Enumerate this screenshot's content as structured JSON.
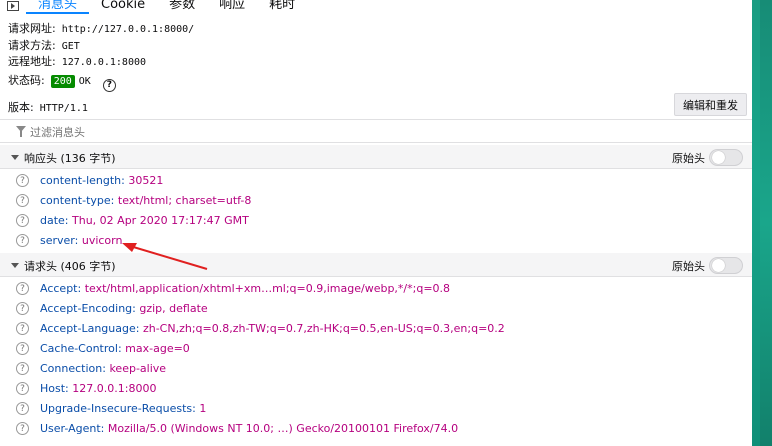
{
  "tabs": [
    {
      "label": "消息头",
      "active": true
    },
    {
      "label": "Cookie",
      "active": false
    },
    {
      "label": "参数",
      "active": false
    },
    {
      "label": "响应",
      "active": false
    },
    {
      "label": "耗时",
      "active": false
    }
  ],
  "summary": {
    "request_url_label": "请求网址:",
    "request_url": "http://127.0.0.1:8000/",
    "request_method_label": "请求方法:",
    "request_method": "GET",
    "remote_address_label": "远程地址:",
    "remote_address": "127.0.0.1:8000",
    "status_label": "状态码:",
    "status_code": "200",
    "status_text": "OK",
    "version_label": "版本:",
    "version": "HTTP/1.1"
  },
  "resend_button": "编辑和重发",
  "filter": {
    "placeholder": "过滤消息头"
  },
  "response_headers": {
    "title": "响应头 (136 字节)",
    "raw_label": "原始头",
    "items": [
      {
        "name": "content-length:",
        "value": "30521"
      },
      {
        "name": "content-type:",
        "value": "text/html; charset=utf-8"
      },
      {
        "name": "date:",
        "value": "Thu, 02 Apr 2020 17:17:47 GMT"
      },
      {
        "name": "server:",
        "value": "uvicorn"
      }
    ]
  },
  "request_headers": {
    "title": "请求头 (406 字节)",
    "raw_label": "原始头",
    "items": [
      {
        "name": "Accept:",
        "value": "text/html,application/xhtml+xm…ml;q=0.9,image/webp,*/*;q=0.8"
      },
      {
        "name": "Accept-Encoding:",
        "value": "gzip, deflate"
      },
      {
        "name": "Accept-Language:",
        "value": "zh-CN,zh;q=0.8,zh-TW;q=0.7,zh-HK;q=0.5,en-US;q=0.3,en;q=0.2"
      },
      {
        "name": "Cache-Control:",
        "value": "max-age=0"
      },
      {
        "name": "Connection:",
        "value": "keep-alive"
      },
      {
        "name": "Host:",
        "value": "127.0.0.1:8000"
      },
      {
        "name": "Upgrade-Insecure-Requests:",
        "value": "1"
      },
      {
        "name": "User-Agent:",
        "value": "Mozilla/5.0 (Windows NT 10.0; …) Gecko/20100101 Firefox/74.0"
      }
    ]
  },
  "icons": {
    "help": "?",
    "sidebar_toggle": "sidebar-toggle-icon",
    "filter": "filter-icon",
    "annotation": "red-arrow"
  },
  "colors": {
    "accent": "#0a84ff",
    "status_ok": "#058b00",
    "header_name": "#0a4da8",
    "header_value": "#b5007f",
    "annotation_arrow": "#e02020",
    "side_strip": "#17a58a"
  }
}
